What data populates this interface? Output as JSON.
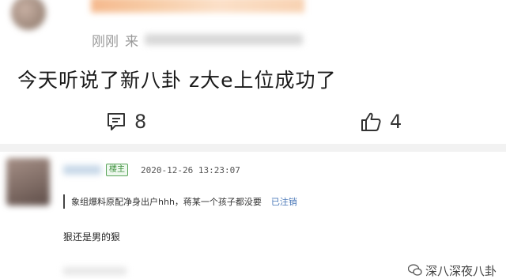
{
  "post": {
    "meta_prefix": "刚刚",
    "meta_from": "来",
    "text": "今天听说了新八卦 z大e上位成功了",
    "comment_count": "8",
    "like_count": "4"
  },
  "comment": {
    "badge": "楼主",
    "datetime": "2020-12-26 13:23:07",
    "quote_text": "象组爆料原配净身出户hhh，蒋某一个孩子都没要",
    "quote_status": "已注销",
    "reply_text": "狠还是男的狠"
  },
  "watermark": {
    "text": "深八深夜八卦"
  },
  "colors": {
    "deleted_link": "#4a78b8",
    "badge_green": "#3b8f3b",
    "divider": "#f2f2f2"
  }
}
